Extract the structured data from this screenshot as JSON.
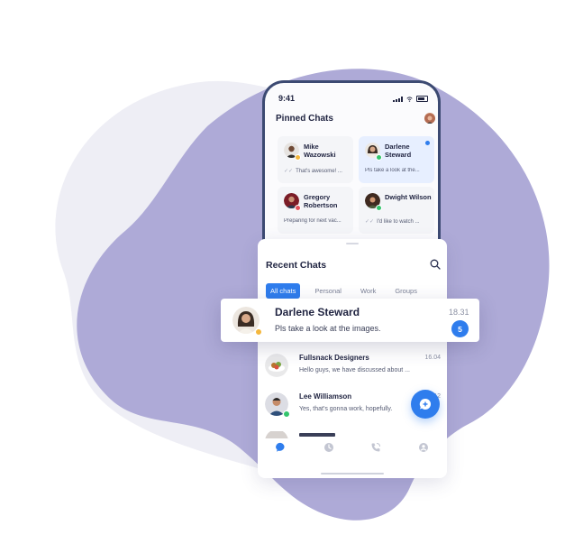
{
  "colors": {
    "accent": "#2f7ded",
    "blob_purple": "#aeaad7",
    "blob_light": "#eeeef5",
    "text_dark": "#1f2340",
    "online_green": "#33c46c",
    "away_yellow": "#f4b73e",
    "busy_red": "#e2525b"
  },
  "status_bar": {
    "time": "9:41"
  },
  "pinned": {
    "title": "Pinned Chats",
    "items": [
      {
        "name": "Mike Wazowski",
        "message": "That's awesome! ...",
        "status": "away"
      },
      {
        "name": "Darlene Steward",
        "message": "Pls take a look at the...",
        "status": "online",
        "unread": true
      },
      {
        "name": "Gregory Robertson",
        "message": "Preparing for next vac...",
        "status": "busy"
      },
      {
        "name": "Dwight Wilson",
        "message": "I'd like to watch ...",
        "status": "online"
      }
    ]
  },
  "recent": {
    "title": "Recent Chats",
    "tabs": [
      "All chats",
      "Personal",
      "Work",
      "Groups"
    ],
    "active_tab": "All chats",
    "highlighted": {
      "name": "Darlene Steward",
      "message": "Pls take a look at the images.",
      "time": "18.31",
      "unread": "5"
    },
    "chats": [
      {
        "name": "Fullsnack Designers",
        "message": "Hello guys, we have discussed about ...",
        "time": "16.04"
      },
      {
        "name": "Lee Williamson",
        "message": "Yes, that's gonna work, hopefully.",
        "time": "06.12"
      }
    ]
  },
  "icons": {
    "search": "search-icon",
    "new_chat": "new-chat-icon",
    "nav": [
      "chats-icon",
      "clock-icon",
      "phone-icon",
      "profile-icon"
    ]
  }
}
